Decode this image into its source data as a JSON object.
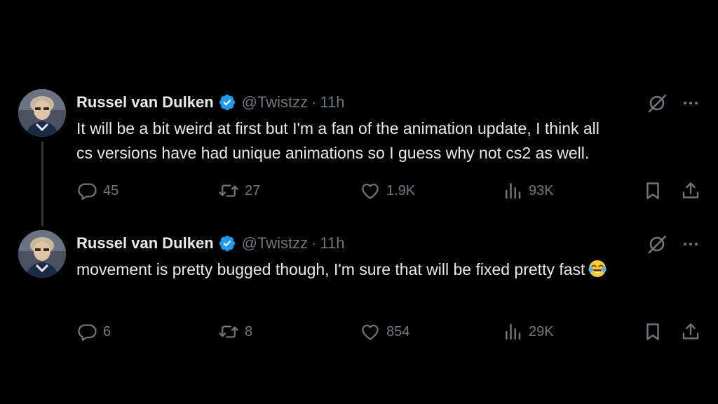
{
  "tweets": [
    {
      "author_name": "Russel van Dulken",
      "handle": "@Twistzz",
      "separator": "·",
      "time": "11h",
      "text_lines": [
        "It will be a bit weird at first but I'm a fan of the animation update, I think all",
        "cs versions have had unique animations so I guess why not cs2 as well."
      ],
      "replies": "45",
      "reposts": "27",
      "likes": "1.9K",
      "views": "93K",
      "icons": [
        "reply-icon",
        "repost-icon",
        "like-icon",
        "views-icon",
        "bookmark-icon",
        "share-icon",
        "grok-icon",
        "more-icon",
        "verified-icon"
      ]
    },
    {
      "author_name": "Russel van Dulken",
      "handle": "@Twistzz",
      "separator": "·",
      "time": "11h",
      "text_lines": [
        "movement is pretty bugged though, I'm sure that will be fixed pretty fast"
      ],
      "emoji": "face-with-tears-of-joy",
      "replies": "6",
      "reposts": "8",
      "likes": "854",
      "views": "29K"
    }
  ],
  "colors": {
    "background": "#000000",
    "primary_text": "#e7e9ea",
    "secondary_text": "#71767b",
    "verified_blue": "#1d9bf0",
    "thread_line": "#333639"
  }
}
